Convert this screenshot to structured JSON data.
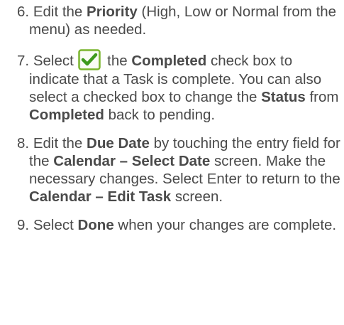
{
  "steps": [
    {
      "number": "6.",
      "parts": [
        "Edit the ",
        "Priority",
        " (High, Low or Normal from the menu) as needed."
      ]
    },
    {
      "number": "7.",
      "icon": "checkbox-checked-icon",
      "parts": [
        "Select ",
        " the ",
        "Completed",
        " check box to indicate that a Task is complete. You can also select a checked box to change the ",
        "Status",
        " from ",
        "Completed",
        " back to pending."
      ]
    },
    {
      "number": "8.",
      "parts": [
        "Edit the ",
        "Due Date",
        " by touching the entry field for the ",
        "Calendar – Select Date",
        " screen. Make the necessary changes. Select Enter to return to the ",
        "Calendar – Edit Task",
        " screen."
      ]
    },
    {
      "number": "9.",
      "parts": [
        "Select ",
        "Done",
        " when your changes are complete."
      ]
    }
  ],
  "colors": {
    "text": "#4a4a4a",
    "icon_border": "#7ab52e",
    "icon_check": "#3e9a1e"
  }
}
